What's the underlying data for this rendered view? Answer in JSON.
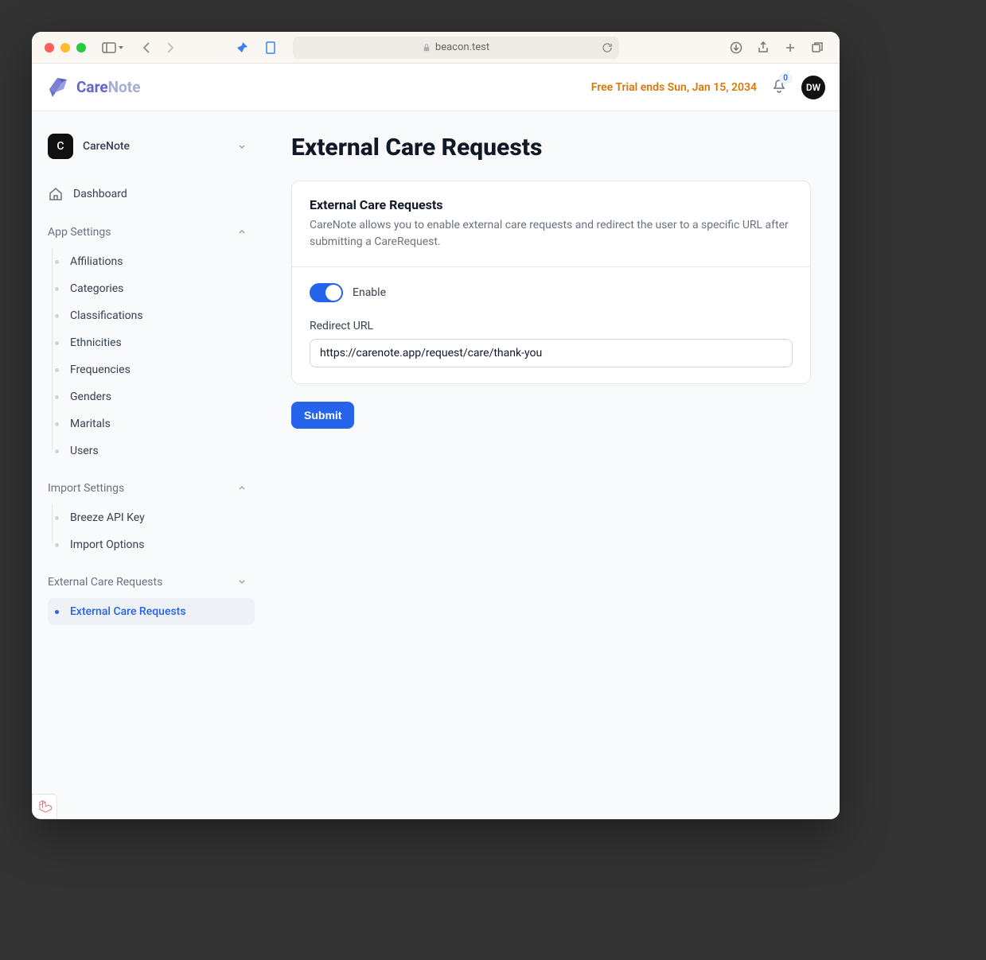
{
  "browser": {
    "address": "beacon.test"
  },
  "header": {
    "brand_care": "Care",
    "brand_note": "Note",
    "trial_text": "Free Trial ends Sun, Jan 15, 2034",
    "notification_count": "0",
    "avatar_initials": "DW"
  },
  "sidebar": {
    "org_initial": "C",
    "org_name": "CareNote",
    "dashboard_label": "Dashboard",
    "sections": {
      "app_settings": {
        "label": "App Settings",
        "items": [
          "Affiliations",
          "Categories",
          "Classifications",
          "Ethnicities",
          "Frequencies",
          "Genders",
          "Maritals",
          "Users"
        ]
      },
      "import_settings": {
        "label": "Import Settings",
        "items": [
          "Breeze API Key",
          "Import Options"
        ]
      },
      "external": {
        "label": "External Care Requests",
        "items": [
          "External Care Requests"
        ]
      }
    }
  },
  "main": {
    "page_title": "External Care Requests",
    "card_title": "External Care Requests",
    "card_desc": "CareNote allows you to enable external care requests and redirect the user to a specific URL after submitting a CareRequest.",
    "toggle_label": "Enable",
    "redirect_label": "Redirect URL",
    "redirect_value": "https://carenote.app/request/care/thank-you",
    "submit_label": "Submit"
  }
}
